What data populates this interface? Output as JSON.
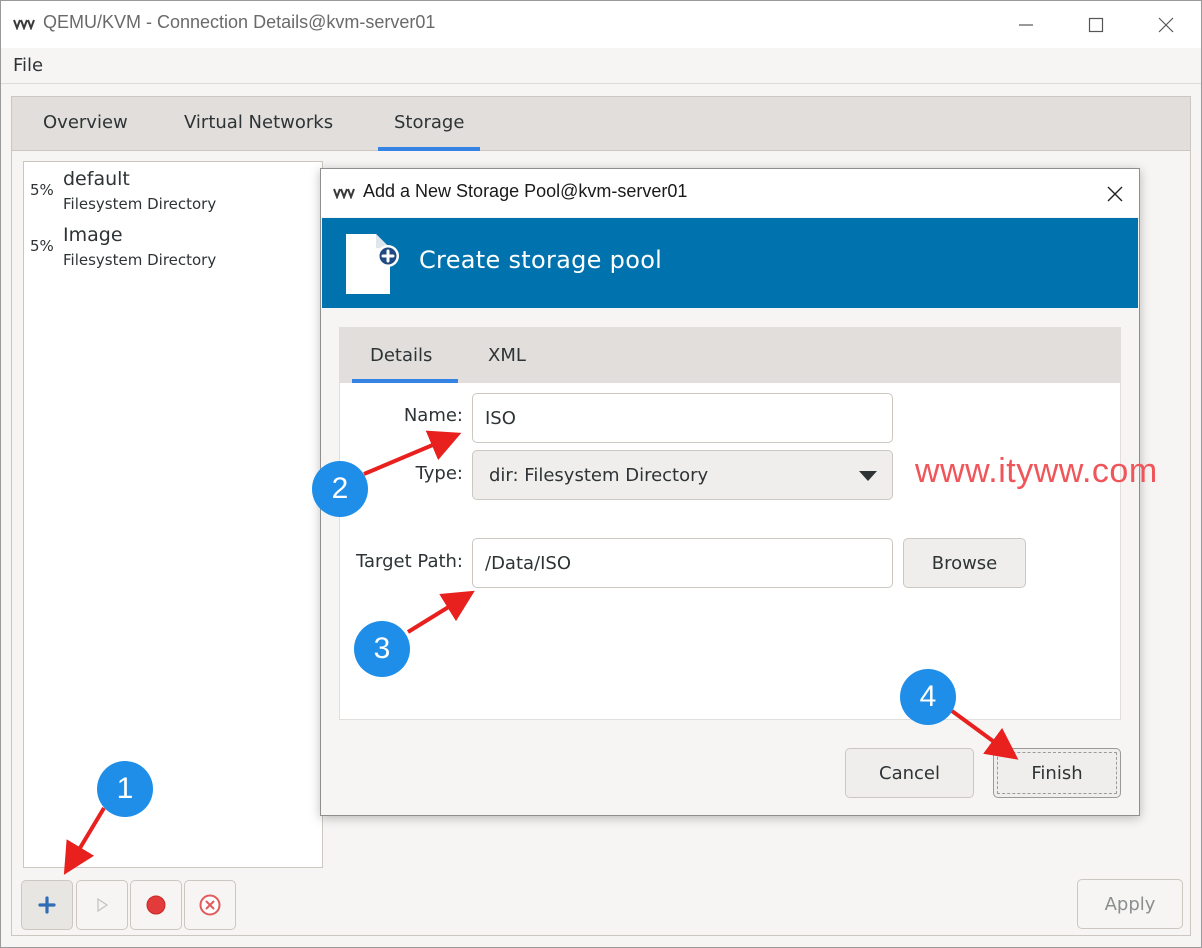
{
  "main_window": {
    "title": "QEMU/KVM - Connection Details@kvm-server01",
    "menu": {
      "file": "File"
    },
    "tabs": [
      {
        "label": "Overview"
      },
      {
        "label": "Virtual Networks"
      },
      {
        "label": "Storage",
        "active": true
      }
    ],
    "pools": [
      {
        "percent": "5%",
        "name": "default",
        "type": "Filesystem Directory"
      },
      {
        "percent": "5%",
        "name": "Image",
        "type": "Filesystem Directory"
      }
    ],
    "toolbar": {
      "add": "add-pool-icon",
      "start": "play-icon",
      "stop": "stop-icon",
      "delete": "delete-icon"
    },
    "apply_label": "Apply"
  },
  "dialog": {
    "title": "Add a New Storage Pool@kvm-server01",
    "header": "Create storage pool",
    "tabs": [
      {
        "label": "Details",
        "active": true
      },
      {
        "label": "XML"
      }
    ],
    "form": {
      "name_label": "Name:",
      "name_value": "ISO",
      "type_label": "Type:",
      "type_value": "dir: Filesystem Directory",
      "path_label": "Target Path:",
      "path_value": "/Data/ISO",
      "browse_label": "Browse"
    },
    "cancel_label": "Cancel",
    "finish_label": "Finish"
  },
  "annotations": {
    "watermark": "www.ityww.com",
    "steps": [
      "1",
      "2",
      "3",
      "4"
    ],
    "colors": {
      "badge": "#1e8ee9",
      "arrow": "#e8201e",
      "header": "#0073ae"
    }
  }
}
